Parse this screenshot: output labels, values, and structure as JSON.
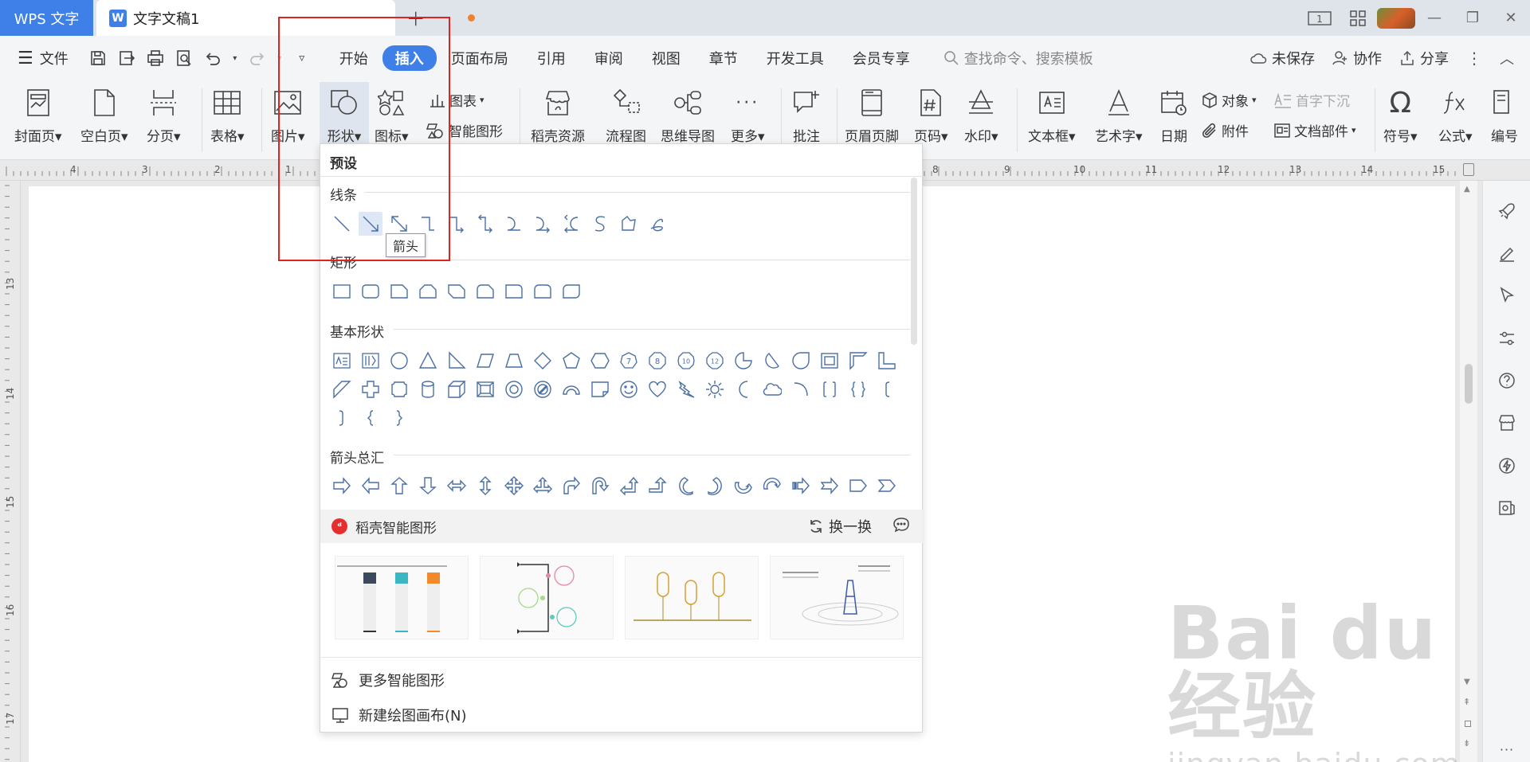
{
  "titlebar": {
    "app_tab": "WPS 文字",
    "doc_tab": "文字文稿1",
    "doc_icon_letter": "W",
    "new_tab_symbol": "+",
    "page_count_icon": "1"
  },
  "menubar": {
    "file": "文件",
    "tabs": [
      "开始",
      "插入",
      "页面布局",
      "引用",
      "审阅",
      "视图",
      "章节",
      "开发工具",
      "会员专享"
    ],
    "active_tab": "插入",
    "search_placeholder": "查找命令、搜索模板",
    "unsaved": "未保存",
    "collab": "协作",
    "share": "分享"
  },
  "ribbon": {
    "cover": "封面页",
    "blank": "空白页",
    "pagebreak": "分页",
    "table": "表格",
    "picture": "图片",
    "shape": "形状",
    "icon": "图标",
    "chart": "图表",
    "smartart": "智能图形",
    "daoke": "稻壳资源",
    "flowchart": "流程图",
    "mindmap": "思维导图",
    "more": "更多",
    "comment": "批注",
    "headerfooter": "页眉页脚",
    "pagenum": "页码",
    "watermark": "水印",
    "textbox": "文本框",
    "wordart": "艺术字",
    "date": "日期",
    "object": "对象",
    "dropcap": "首字下沉",
    "attachment": "附件",
    "docpart": "文档部件",
    "symbol": "符号",
    "formula": "公式",
    "edit": "编号"
  },
  "ruler": {
    "h_labels": [
      "4",
      "3",
      "2",
      "1",
      "8",
      "9",
      "10",
      "11",
      "12",
      "13",
      "14",
      "15"
    ],
    "v_labels": [
      "13",
      "14",
      "15",
      "16",
      "17"
    ]
  },
  "dropdown": {
    "header": "预设",
    "sections": {
      "lines": "线条",
      "rect": "矩形",
      "basic": "基本形状",
      "arrows": "箭头总汇"
    },
    "tooltip": "箭头",
    "basic_numbers": [
      "7",
      "8",
      "10",
      "12"
    ],
    "smart_title": "稻壳智能图形",
    "refresh": "换一换",
    "more_smart": "更多智能图形",
    "new_canvas": "新建绘图画布(N)"
  },
  "watermark": {
    "brand": "Bai du经验",
    "url": "jingyan.baidu.com"
  },
  "colors": {
    "accent": "#3e80e8",
    "highlight": "#e2221f",
    "shape_stroke": "#4a6fa5"
  }
}
